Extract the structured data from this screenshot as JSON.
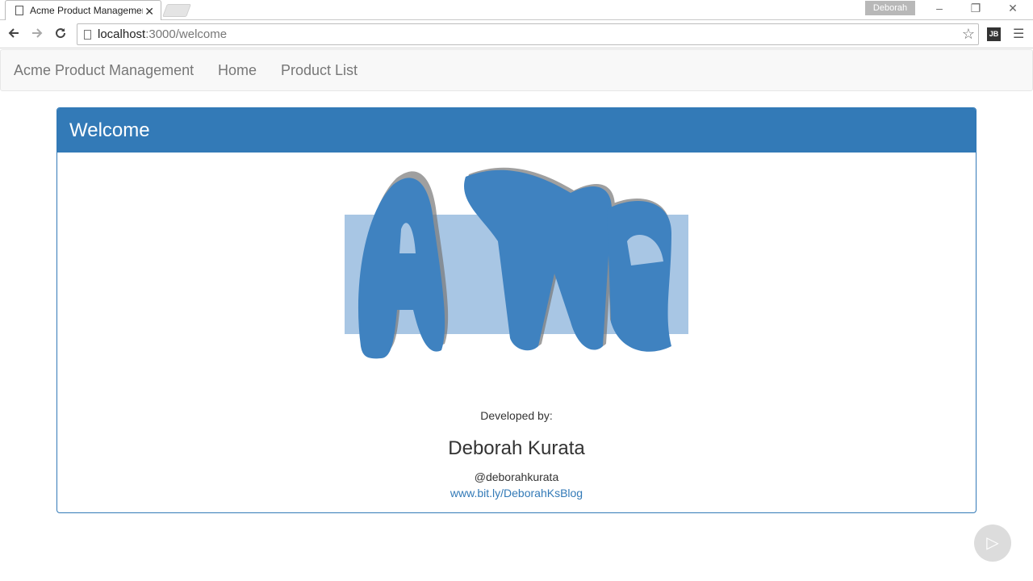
{
  "browser": {
    "tab_title": "Acme Product Management",
    "profile_name": "Deborah",
    "url_host": "localhost",
    "url_path": ":3000/welcome",
    "extension_label": "JB"
  },
  "navbar": {
    "brand": "Acme Product Management",
    "items": [
      {
        "label": "Home"
      },
      {
        "label": "Product List"
      }
    ]
  },
  "panel": {
    "title": "Welcome",
    "logo_text": "AcMe",
    "developed_by_label": "Developed by:",
    "developer_name": "Deborah Kurata",
    "developer_handle": "@deborahkurata",
    "blog_link": "www.bit.ly/DeborahKsBlog"
  },
  "colors": {
    "primary": "#337ab7",
    "logo_blue": "#3f82c0",
    "logo_backdrop": "#a8c6e4",
    "navbar_bg": "#f8f8f8"
  }
}
